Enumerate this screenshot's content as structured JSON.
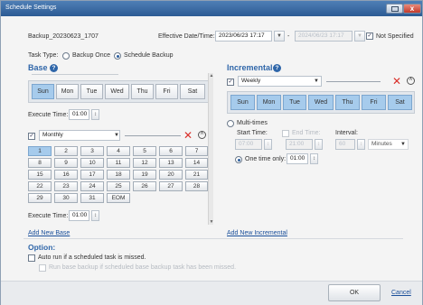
{
  "window": {
    "title": "Schedule Settings",
    "close": "x"
  },
  "task": {
    "name": "Backup_20230623_1707",
    "effective_label": "Effective Date/Time:",
    "start_value": "2023/06/23 17:17",
    "end_value": "2024/06/23 17:17",
    "dash": "-",
    "not_specified_label": "Not Specified",
    "type_label": "Task Type:",
    "type_options": [
      "Backup Once",
      "Schedule Backup"
    ],
    "type_selected": "Schedule Backup"
  },
  "base": {
    "heading": "Base",
    "weekdays": [
      "Sun",
      "Mon",
      "Tue",
      "Wed",
      "Thu",
      "Fri",
      "Sat"
    ],
    "selected_day": "Sun",
    "exec_label": "Execute Time:",
    "exec_time": "01:00",
    "monthly_value": "Monthly",
    "month_days": [
      "1",
      "2",
      "3",
      "4",
      "5",
      "6",
      "7",
      "8",
      "9",
      "10",
      "11",
      "12",
      "13",
      "14",
      "15",
      "16",
      "17",
      "18",
      "19",
      "20",
      "21",
      "22",
      "23",
      "24",
      "25",
      "26",
      "27",
      "28",
      "29",
      "30",
      "31",
      "EOM"
    ],
    "selected_month_day": "1",
    "exec2_label": "Execute Time:",
    "exec2_time": "01:00",
    "add_link": "Add New Base"
  },
  "incremental": {
    "heading": "Incremental",
    "weekly_value": "Weekly",
    "weekdays": [
      "Sun",
      "Mon",
      "Tue",
      "Wed",
      "Thu",
      "Fri",
      "Sat"
    ],
    "multi_label": "Multi-times",
    "start_label": "Start Time:",
    "start_value": "07:00",
    "end_label": "End Time:",
    "end_value": "21:00",
    "interval_label": "Interval:",
    "interval_value": "60",
    "interval_unit": "Minutes",
    "one_time_label": "One time only:",
    "one_time_value": "01:00",
    "add_link": "Add New Incremental"
  },
  "option": {
    "heading": "Option:",
    "auto_run": "Auto run if a scheduled task is missed.",
    "run_base": "Run base backup if scheduled base backup task has been missed."
  },
  "buttons": {
    "ok": "OK",
    "cancel": "Cancel"
  },
  "icons": {
    "spinner": "↕",
    "dropdown": "▼",
    "close_x": "✕",
    "collapse": "˄",
    "check": "✓",
    "help": "?"
  }
}
